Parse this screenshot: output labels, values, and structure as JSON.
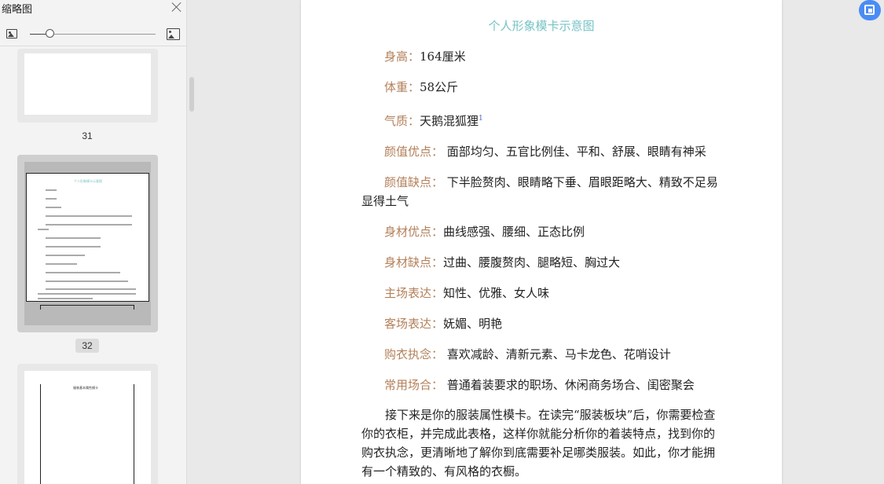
{
  "sidebar": {
    "title": "缩略图",
    "thumbnails": [
      {
        "page_number": "31"
      },
      {
        "page_number": "32"
      }
    ],
    "mini_title_32": "个人形象模卡示意图",
    "mini_title_33": "服装基本属性模卡"
  },
  "document": {
    "title": "个人形象模卡示意图",
    "rows": [
      {
        "label": "身高：",
        "value": "164厘米"
      },
      {
        "label": "体重：",
        "value": "58公斤"
      },
      {
        "label": "气质：",
        "value": "天鹅混狐狸",
        "footnote": "1"
      },
      {
        "label": "颜值优点：",
        "value": " 面部均匀、五官比例佳、平和、舒展、眼睛有神采"
      },
      {
        "label": "颜值缺点：",
        "value": " 下半脸赘肉、眼睛略下垂、眉眼距略大、精致不足易",
        "cont": "显得土气"
      },
      {
        "label": "身材优点：",
        "value": "曲线感强、腰细、正态比例"
      },
      {
        "label": "身材缺点：",
        "value": "过曲、腰腹赘肉、腿略短、胸过大"
      },
      {
        "label": "主场表达：",
        "value": "知性、优雅、女人味"
      },
      {
        "label": "客场表达：",
        "value": "妩媚、明艳"
      },
      {
        "label": "购衣执念：",
        "value": " 喜欢减龄、清新元素、马卡龙色、花哨设计"
      },
      {
        "label": "常用场合：",
        "value": " 普通着装要求的职场、休闲商务场合、闺密聚会"
      }
    ],
    "paragraph": "接下来是你的服装属性模卡。在读完“服装板块”后，你需要检查你的衣柜，并完成此表格，这样你就能分析你的着装特点，找到你的购衣执念，更清晰地了解你到底需要补足哪类服装。如此，你才能拥有一个精致的、有风格的衣橱。"
  }
}
